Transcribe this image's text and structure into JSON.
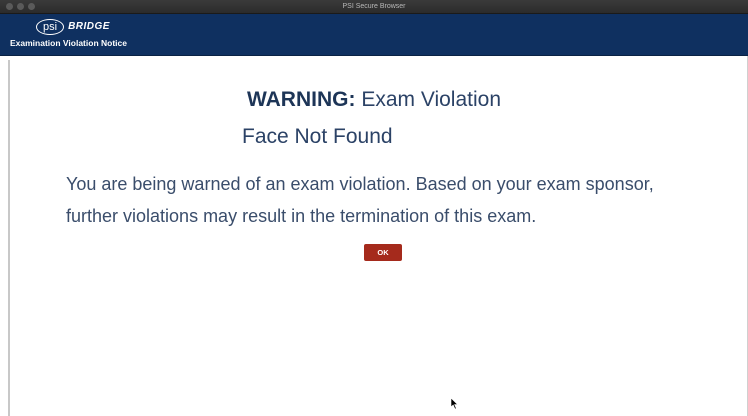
{
  "window": {
    "title": "PSI Secure Browser"
  },
  "header": {
    "logo_psi": "psi",
    "logo_bridge": "BRIDGE",
    "notice_title": "Examination Violation Notice"
  },
  "dialog": {
    "warning_label": "WARNING:",
    "warning_text": " Exam Violation",
    "subtitle": "Face Not Found",
    "message": "You are being warned of an exam violation. Based on your exam sponsor, further violations may result in the termination of this exam.",
    "ok_label": "OK"
  },
  "colors": {
    "header_bg": "#0f3060",
    "ok_button_bg": "#a52a1c",
    "text_primary": "#1d3557"
  }
}
